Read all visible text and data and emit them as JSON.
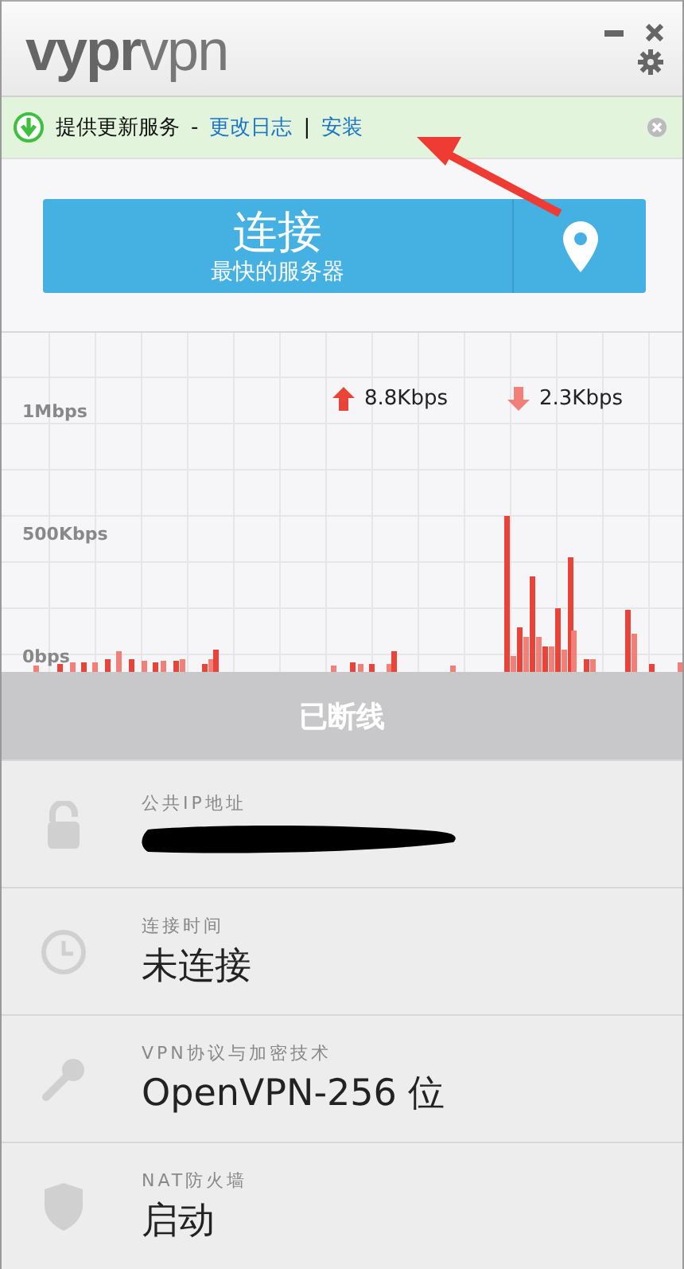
{
  "window": {
    "logo_bold": "vypr",
    "logo_light": "vpn"
  },
  "update_banner": {
    "message": "提供更新服务",
    "separator": "-",
    "divider": "|",
    "links": [
      {
        "label": "更改日志"
      },
      {
        "label": "安装"
      }
    ]
  },
  "connect_button": {
    "label": "连接",
    "sublabel": "最快的服务器"
  },
  "traffic": {
    "upload": "8.8Kbps",
    "download": "2.3Kbps",
    "axis_labels": [
      "1Mbps",
      "500Kbps",
      "0bps"
    ]
  },
  "status": {
    "label": "已断线"
  },
  "info_rows": [
    {
      "kind": "lock",
      "label": "公共IP地址",
      "redacted": true
    },
    {
      "kind": "clock",
      "label": "连接时间",
      "value": "未连接"
    },
    {
      "kind": "key",
      "label": "VPN协议与加密技术",
      "value": "OpenVPN-256 位"
    },
    {
      "kind": "shield",
      "label": "NAT防火墙",
      "value": "启动"
    }
  ]
}
